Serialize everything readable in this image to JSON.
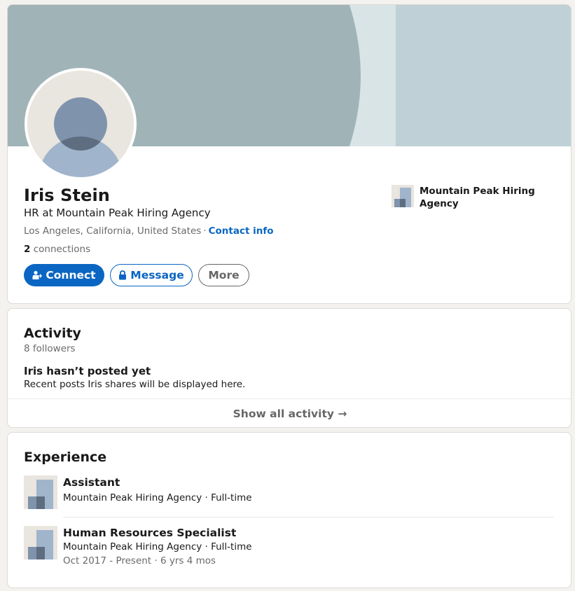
{
  "profile": {
    "name": "Iris Stein",
    "headline": "HR at Mountain Peak Hiring Agency",
    "location": "Los Angeles, California, United States",
    "separator": "·",
    "contact_info": "Contact info",
    "connections_count": "2",
    "connections_label": "connections",
    "current_company": "Mountain Peak Hiring Agency",
    "buttons": {
      "connect": "Connect",
      "message": "Message",
      "more": "More"
    }
  },
  "activity": {
    "title": "Activity",
    "followers": "8 followers",
    "empty_title": "Iris hasn’t posted yet",
    "empty_desc": "Recent posts Iris shares will be displayed here.",
    "show_all": "Show all activity →"
  },
  "experience": {
    "title": "Experience",
    "items": [
      {
        "title": "Assistant",
        "company": "Mountain Peak Hiring Agency · Full-time",
        "dates": ""
      },
      {
        "title": "Human Resources Specialist",
        "company": "Mountain Peak Hiring Agency · Full-time",
        "dates": "Oct 2017 - Present · 6 yrs 4 mos"
      }
    ]
  },
  "colors": {
    "accent": "#0a66c2",
    "banner_left": "#a0b4b8",
    "banner_mid": "#d9e4e6",
    "banner_right": "#bfd1d6",
    "page_bg": "#f3f2ef"
  },
  "icons": {
    "connect": "person-add-icon",
    "message": "lock-icon",
    "company_logo": "company-logo-icon",
    "avatar": "default-avatar-icon"
  }
}
